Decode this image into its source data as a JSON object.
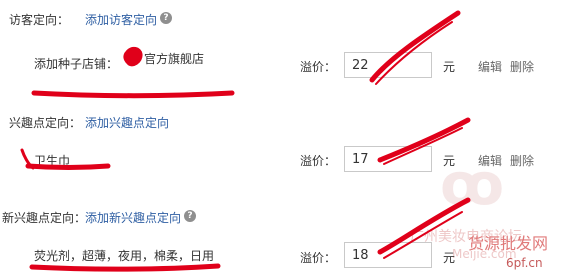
{
  "sections": [
    {
      "heading": "访客定向：",
      "add_link": "添加访客定向",
      "item_label": "添加种子店铺：",
      "item_value": "官方旗舰店",
      "price_label": "溢价：",
      "price_value": "22",
      "unit": "元",
      "edit": "编辑",
      "delete": "删除"
    },
    {
      "heading": "兴趣点定向：",
      "add_link": "添加兴趣点定向",
      "item_value": "卫生巾",
      "price_label": "溢价：",
      "price_value": "17",
      "unit": "元",
      "edit": "编辑",
      "delete": "删除"
    },
    {
      "heading": "新兴趣点定向：",
      "add_link": "添加新兴趣点定向",
      "item_value": "荧光剂，超薄，夜用，棉柔，日用",
      "price_label": "溢价：",
      "price_value": "18",
      "unit": "元",
      "edit": "编辑",
      "delete": "删除"
    }
  ],
  "help_glyph": "?",
  "watermark": {
    "line1": "广州美妆电商论坛",
    "line2": "Meijie.com",
    "line3": "货源批发网",
    "line4": "6pf.cn"
  },
  "colors": {
    "link": "#2f5fa3",
    "scribble": "#e0001a",
    "help_icon": "#8f8f8f"
  }
}
